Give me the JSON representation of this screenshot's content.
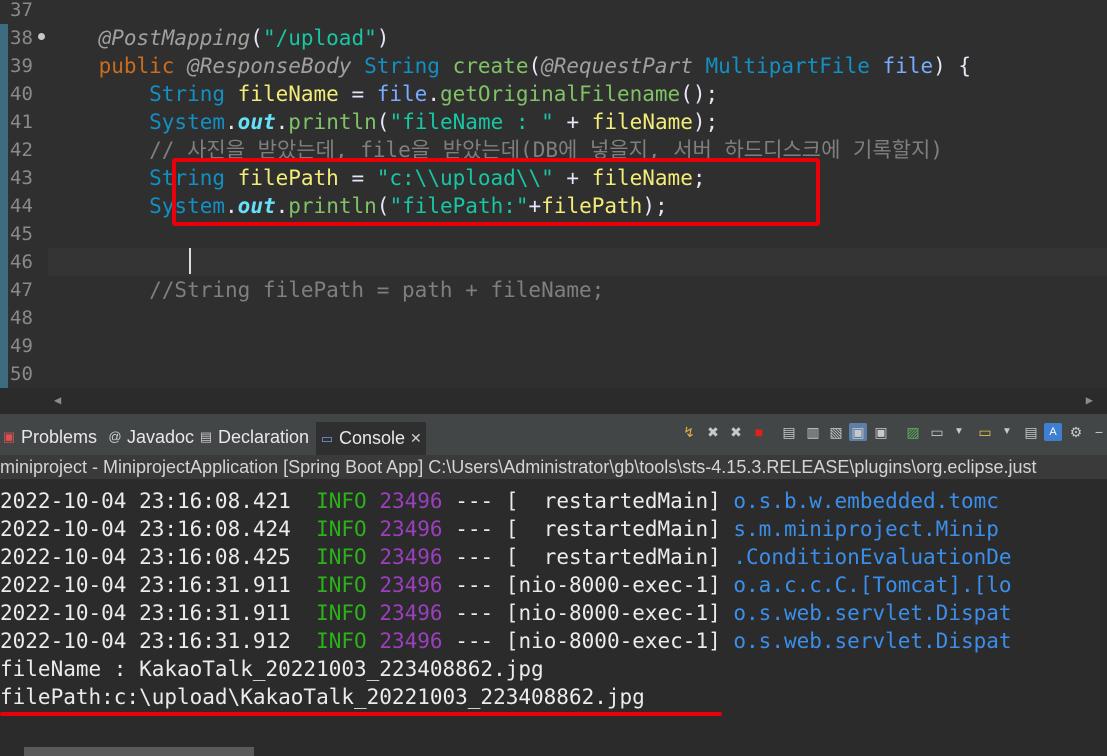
{
  "editor": {
    "line_numbers": [
      "37",
      "38",
      "39",
      "40",
      "41",
      "42",
      "43",
      "44",
      "45",
      "46",
      "47",
      "48",
      "49",
      "50"
    ],
    "lines": [
      [],
      [
        {
          "t": "    @PostMapping",
          "c": "ann"
        },
        {
          "t": "(",
          "c": "op"
        },
        {
          "t": "\"/upload\"",
          "c": "str"
        },
        {
          "t": ")",
          "c": "op"
        }
      ],
      [
        {
          "t": "    public ",
          "c": "kw"
        },
        {
          "t": "@ResponseBody ",
          "c": "ann"
        },
        {
          "t": "String ",
          "c": "type"
        },
        {
          "t": "create",
          "c": "meth"
        },
        {
          "t": "(",
          "c": "op"
        },
        {
          "t": "@RequestPart ",
          "c": "ann"
        },
        {
          "t": "MultipartFile ",
          "c": "type"
        },
        {
          "t": "file",
          "c": "param"
        },
        {
          "t": ") {",
          "c": "op"
        }
      ],
      [
        {
          "t": "        String ",
          "c": "type"
        },
        {
          "t": "fileName",
          "c": "var"
        },
        {
          "t": " = ",
          "c": "op"
        },
        {
          "t": "file",
          "c": "param"
        },
        {
          "t": ".",
          "c": "op"
        },
        {
          "t": "getOriginalFilename",
          "c": "meth"
        },
        {
          "t": "();",
          "c": "op"
        }
      ],
      [
        {
          "t": "        System",
          "c": "type"
        },
        {
          "t": ".",
          "c": "op"
        },
        {
          "t": "out",
          "c": "fld"
        },
        {
          "t": ".",
          "c": "op"
        },
        {
          "t": "println",
          "c": "meth"
        },
        {
          "t": "(",
          "c": "op"
        },
        {
          "t": "\"fileName : \"",
          "c": "str"
        },
        {
          "t": " + ",
          "c": "op"
        },
        {
          "t": "fileName",
          "c": "var"
        },
        {
          "t": ");",
          "c": "op"
        }
      ],
      [
        {
          "t": "        // 사진을 받았는데, file을 받았는데(DB에 넣을지, 서버 하드디스크에 기록할지)",
          "c": "cmt"
        }
      ],
      [
        {
          "t": "        String ",
          "c": "type"
        },
        {
          "t": "filePath",
          "c": "var"
        },
        {
          "t": " = ",
          "c": "op"
        },
        {
          "t": "\"c:\\\\upload\\\\\"",
          "c": "str"
        },
        {
          "t": " + ",
          "c": "op"
        },
        {
          "t": "fileName",
          "c": "var"
        },
        {
          "t": ";",
          "c": "op"
        }
      ],
      [
        {
          "t": "        System",
          "c": "type"
        },
        {
          "t": ".",
          "c": "op"
        },
        {
          "t": "out",
          "c": "fld"
        },
        {
          "t": ".",
          "c": "op"
        },
        {
          "t": "println",
          "c": "meth"
        },
        {
          "t": "(",
          "c": "op"
        },
        {
          "t": "\"filePath:\"",
          "c": "str"
        },
        {
          "t": "+",
          "c": "op"
        },
        {
          "t": "filePath",
          "c": "var"
        },
        {
          "t": ");",
          "c": "op"
        }
      ],
      [],
      [],
      [
        {
          "t": "        //String filePath = path + fileName;",
          "c": "cmt"
        }
      ],
      [],
      [],
      []
    ]
  },
  "tabs": {
    "problems": "Problems",
    "javadoc": "Javadoc",
    "declaration": "Declaration",
    "console": "Console",
    "close_glyph": "✕"
  },
  "launch_line": "miniproject - MiniprojectApplication [Spring Boot App] C:\\Users\\Administrator\\gb\\tools\\sts-4.15.3.RELEASE\\plugins\\org.eclipse.just",
  "console": {
    "logs": [
      {
        "ts": "2022-10-04 23:16:08.421",
        "level": "INFO",
        "pid": "23496",
        "sep": "---",
        "thread": "[  restartedMain]",
        "logger": "o.s.b.w.embedded.tomc"
      },
      {
        "ts": "2022-10-04 23:16:08.424",
        "level": "INFO",
        "pid": "23496",
        "sep": "---",
        "thread": "[  restartedMain]",
        "logger": "s.m.miniproject.Minip"
      },
      {
        "ts": "2022-10-04 23:16:08.425",
        "level": "INFO",
        "pid": "23496",
        "sep": "---",
        "thread": "[  restartedMain]",
        "logger": ".ConditionEvaluationDe"
      },
      {
        "ts": "2022-10-04 23:16:31.911",
        "level": "INFO",
        "pid": "23496",
        "sep": "---",
        "thread": "[nio-8000-exec-1]",
        "logger": "o.a.c.c.C.[Tomcat].[lo"
      },
      {
        "ts": "2022-10-04 23:16:31.911",
        "level": "INFO",
        "pid": "23496",
        "sep": "---",
        "thread": "[nio-8000-exec-1]",
        "logger": "o.s.web.servlet.Dispat"
      },
      {
        "ts": "2022-10-04 23:16:31.912",
        "level": "INFO",
        "pid": "23496",
        "sep": "---",
        "thread": "[nio-8000-exec-1]",
        "logger": "o.s.web.servlet.Dispat"
      }
    ],
    "output": [
      "fileName : KakaoTalk_20221003_223408862.jpg",
      "filePath:c:\\upload\\KakaoTalk_20221003_223408862.jpg"
    ]
  },
  "colors": {
    "highlight": "#e8000b",
    "info": "#2cb21a",
    "pid": "#9c3fbf"
  }
}
